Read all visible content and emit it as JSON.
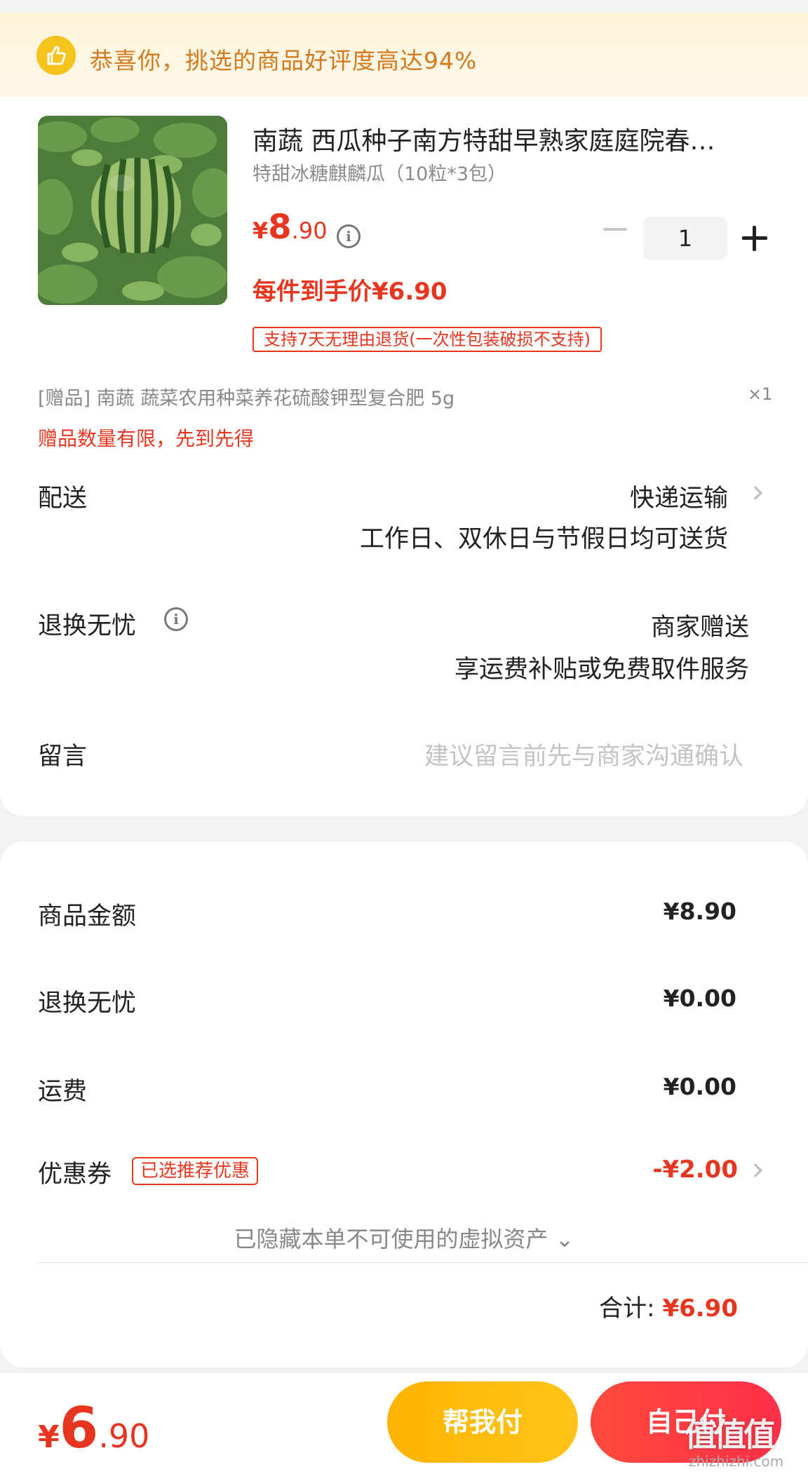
{
  "banner": {
    "text": "恭喜你，挑选的商品好评度高达94%",
    "icon": "thumbs-up-icon"
  },
  "product": {
    "title": "南蔬 西瓜种子南方特甜早熟家庭庭院春…",
    "spec": "特甜冰糖麒麟瓜（10粒*3包）",
    "price_currency": "¥",
    "price_int": "8",
    "price_dec": ".90",
    "quantity": "1",
    "final_price": "每件到手价¥6.90",
    "return_tag": "支持7天无理由退货(一次性包装破损不支持)",
    "image": "watermelon-photo"
  },
  "gift": {
    "text": "[赠品]  南蔬 蔬菜农用种菜养花硫酸钾型复合肥 5g",
    "qty": "×1",
    "note": "赠品数量有限，先到先得"
  },
  "delivery": {
    "label": "配送",
    "method": "快递运输",
    "detail": "工作日、双休日与节假日均可送货"
  },
  "worry_free": {
    "label": "退换无忧",
    "value": "商家赠送",
    "detail": "享运费补贴或免费取件服务"
  },
  "message": {
    "label": "留言",
    "placeholder": "建议留言前先与商家沟通确认"
  },
  "summary": {
    "goods_label": "商品金额",
    "goods_value": "¥8.90",
    "worry_label": "退换无忧",
    "worry_value": "¥0.00",
    "shipping_label": "运费",
    "shipping_value": "¥0.00",
    "coupon_label": "优惠券",
    "coupon_tag": "已选推荐优惠",
    "coupon_value": "-¥2.00",
    "hidden_assets": "已隐藏本单不可使用的虚拟资产 ⌄",
    "total_label": "合计:",
    "total_value": "¥6.90"
  },
  "bottom": {
    "currency": "¥",
    "int": "6",
    "dec": ".90",
    "help_pay": "帮我付",
    "self_pay": "自己付"
  },
  "watermark": {
    "text": "值值值",
    "url": "zhizhizhi.com"
  },
  "colors": {
    "accent_red": "#e7361f",
    "banner_orange": "#d4791d",
    "help_button": "#ffb400",
    "self_button": "#ff3a44"
  }
}
